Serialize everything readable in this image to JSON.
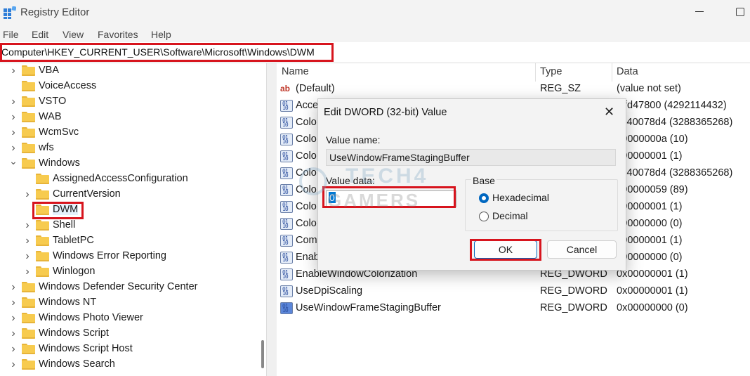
{
  "window": {
    "title": "Registry Editor"
  },
  "menu": [
    "File",
    "Edit",
    "View",
    "Favorites",
    "Help"
  ],
  "address": "Computer\\HKEY_CURRENT_USER\\Software\\Microsoft\\Windows\\DWM",
  "tree": [
    {
      "label": "VBA",
      "depth": 0,
      "expander": "collapsed"
    },
    {
      "label": "VoiceAccess",
      "depth": 0,
      "expander": "none"
    },
    {
      "label": "VSTO",
      "depth": 0,
      "expander": "collapsed"
    },
    {
      "label": "WAB",
      "depth": 0,
      "expander": "collapsed"
    },
    {
      "label": "WcmSvc",
      "depth": 0,
      "expander": "collapsed"
    },
    {
      "label": "wfs",
      "depth": 0,
      "expander": "collapsed"
    },
    {
      "label": "Windows",
      "depth": 0,
      "expander": "expanded"
    },
    {
      "label": "AssignedAccessConfiguration",
      "depth": 1,
      "expander": "none"
    },
    {
      "label": "CurrentVersion",
      "depth": 1,
      "expander": "collapsed"
    },
    {
      "label": "DWM",
      "depth": 1,
      "expander": "none",
      "selected": true
    },
    {
      "label": "Shell",
      "depth": 1,
      "expander": "collapsed"
    },
    {
      "label": "TabletPC",
      "depth": 1,
      "expander": "collapsed"
    },
    {
      "label": "Windows Error Reporting",
      "depth": 1,
      "expander": "collapsed"
    },
    {
      "label": "Winlogon",
      "depth": 1,
      "expander": "collapsed"
    },
    {
      "label": "Windows Defender Security Center",
      "depth": 0,
      "expander": "collapsed"
    },
    {
      "label": "Windows NT",
      "depth": 0,
      "expander": "collapsed"
    },
    {
      "label": "Windows Photo Viewer",
      "depth": 0,
      "expander": "collapsed"
    },
    {
      "label": "Windows Script",
      "depth": 0,
      "expander": "collapsed"
    },
    {
      "label": "Windows Script Host",
      "depth": 0,
      "expander": "collapsed"
    },
    {
      "label": "Windows Search",
      "depth": 0,
      "expander": "collapsed"
    }
  ],
  "list": {
    "headers": {
      "name": "Name",
      "type": "Type",
      "data": "Data"
    },
    "rows": [
      {
        "name": "(Default)",
        "type": "REG_SZ",
        "data": "(value not set)",
        "icon": "string"
      },
      {
        "name": "Acce",
        "type": "",
        "data": "xffd47800 (4292114432)",
        "icon": "dword"
      },
      {
        "name": "Colo",
        "type": "",
        "data": "xc40078d4 (3288365268)",
        "icon": "dword"
      },
      {
        "name": "Colo",
        "type": "",
        "data": "x0000000a (10)",
        "icon": "dword"
      },
      {
        "name": "Colo",
        "type": "",
        "data": "x00000001 (1)",
        "icon": "dword"
      },
      {
        "name": "Colo",
        "type": "",
        "data": "xc40078d4 (3288365268)",
        "icon": "dword"
      },
      {
        "name": "Colo",
        "type": "",
        "data": "x00000059 (89)",
        "icon": "dword"
      },
      {
        "name": "Colo",
        "type": "",
        "data": "x00000001 (1)",
        "icon": "dword"
      },
      {
        "name": "Colo",
        "type": "",
        "data": "x00000000 (0)",
        "icon": "dword"
      },
      {
        "name": "Com",
        "type": "",
        "data": "x00000001 (1)",
        "icon": "dword"
      },
      {
        "name": "Enab",
        "type": "",
        "data": "x00000000 (0)",
        "icon": "dword"
      },
      {
        "name": "EnableWindowColorization",
        "type": "REG_DWORD",
        "data": "0x00000001 (1)",
        "icon": "dword"
      },
      {
        "name": "UseDpiScaling",
        "type": "REG_DWORD",
        "data": "0x00000001 (1)",
        "icon": "dword"
      },
      {
        "name": "UseWindowFrameStagingBuffer",
        "type": "REG_DWORD",
        "data": "0x00000000 (0)",
        "icon": "dword-selected"
      }
    ]
  },
  "dialog": {
    "title": "Edit DWORD (32-bit) Value",
    "value_name_label": "Value name:",
    "value_name": "UseWindowFrameStagingBuffer",
    "value_data_label": "Value data:",
    "value_data": "0",
    "base_label": "Base",
    "base_options": [
      "Hexadecimal",
      "Decimal"
    ],
    "base_selected": "Hexadecimal",
    "ok_label": "OK",
    "cancel_label": "Cancel"
  },
  "watermark": {
    "line1": "TECH4",
    "line2": "GAMERS"
  },
  "colors": {
    "highlight_box": "#d7141d",
    "accent": "#0067c0",
    "folder": "#f7cb4f"
  }
}
